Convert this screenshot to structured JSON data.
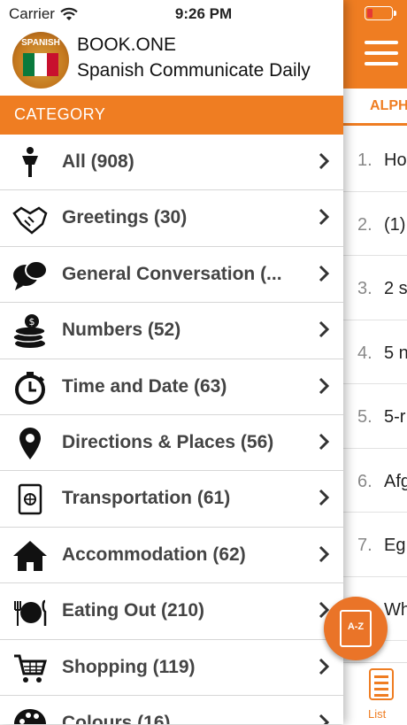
{
  "status_bar": {
    "carrier": "Carrier",
    "time": "9:26 PM"
  },
  "header": {
    "title": "BOOK.ONE",
    "subtitle": "Spanish Communicate Daily",
    "logo_text": "SPANISH"
  },
  "category_bar": {
    "label": "CATEGORY"
  },
  "categories": [
    {
      "label": "All (908)",
      "icon": "person-icon"
    },
    {
      "label": "Greetings (30)",
      "icon": "handshake-icon"
    },
    {
      "label": "General Conversation (...",
      "icon": "chat-bubbles-icon"
    },
    {
      "label": "Numbers (52)",
      "icon": "coins-icon"
    },
    {
      "label": "Time and Date (63)",
      "icon": "stopwatch-icon"
    },
    {
      "label": "Directions & Places (56)",
      "icon": "location-pin-icon"
    },
    {
      "label": "Transportation (61)",
      "icon": "passport-icon"
    },
    {
      "label": "Accommodation (62)",
      "icon": "house-icon"
    },
    {
      "label": "Eating Out (210)",
      "icon": "dining-icon"
    },
    {
      "label": "Shopping (119)",
      "icon": "cart-icon"
    },
    {
      "label": "Colours (16)",
      "icon": "palette-icon"
    }
  ],
  "right_panel": {
    "tab_label": "ALPH",
    "rows": [
      {
        "num": "1.",
        "text": "Ho"
      },
      {
        "num": "2.",
        "text": "(1)"
      },
      {
        "num": "3.",
        "text": "2 s"
      },
      {
        "num": "4.",
        "text": "5 n"
      },
      {
        "num": "5.",
        "text": "5-r"
      },
      {
        "num": "6.",
        "text": "Afg"
      },
      {
        "num": "7.",
        "text": "Eg"
      },
      {
        "num": "",
        "text": "Wh"
      }
    ],
    "list_label": "List",
    "fab_label": "A-Z"
  },
  "colors": {
    "accent": "#ef7d22",
    "fab": "#ea7428"
  }
}
